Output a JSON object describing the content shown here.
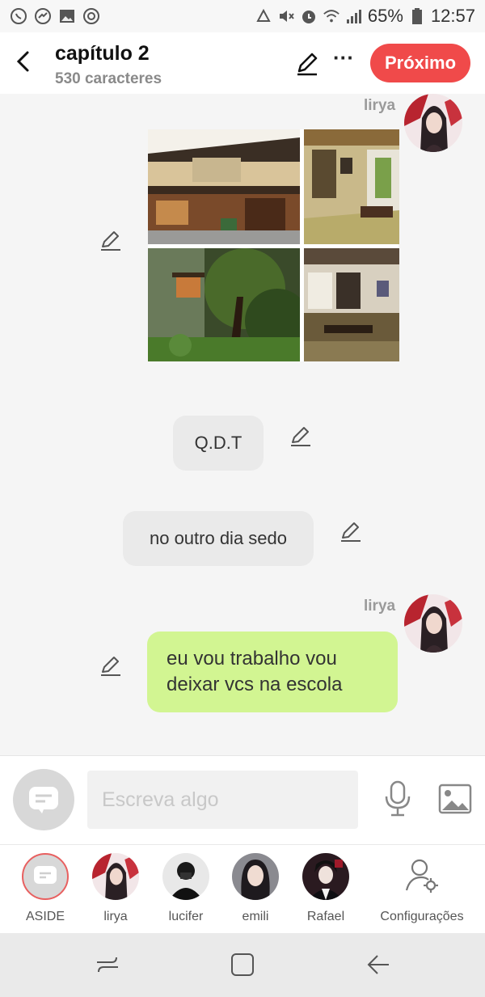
{
  "status_bar": {
    "battery": "65%",
    "time": "12:57",
    "icons": [
      "whatsapp-icon",
      "messenger-icon",
      "gallery-icon",
      "target-icon",
      "recycle-icon",
      "mute-icon",
      "alarm-icon",
      "wifi-icon",
      "signal-icon",
      "battery-icon"
    ]
  },
  "header": {
    "title": "capítulo 2",
    "subtitle": "530 caracteres",
    "next_label": "Próximo",
    "more_label": "···"
  },
  "chat": {
    "messages": [
      {
        "type": "images",
        "speaker": "lirya",
        "image_count": 4
      },
      {
        "type": "text",
        "text": "Q.D.T"
      },
      {
        "type": "text",
        "text": "no outro dia sedo"
      },
      {
        "type": "text",
        "speaker": "lirya",
        "text": "eu vou trabalho vou deixar vcs na escola"
      }
    ]
  },
  "composer": {
    "placeholder": "Escreva algo"
  },
  "characters": [
    {
      "label": "ASIDE"
    },
    {
      "label": "lirya"
    },
    {
      "label": "lucifer"
    },
    {
      "label": "emili"
    },
    {
      "label": "Rafael"
    },
    {
      "label": "Configurações"
    }
  ],
  "colors": {
    "accent": "#f04a4a",
    "bubble_green": "#d2f592",
    "bubble_gray": "#eaeaea"
  }
}
